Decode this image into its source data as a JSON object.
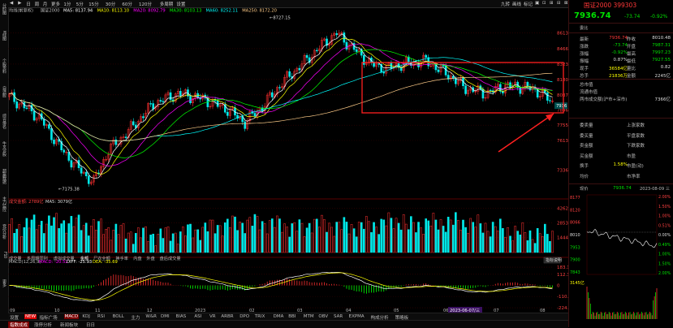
{
  "left_toolbar": {
    "items": [
      "分时图",
      "K线图",
      "个股资料",
      "自选股",
      "综合排名",
      "牛叉诊股",
      "超赢数据",
      "主力监控",
      "竞价分析",
      "F10",
      "更多"
    ]
  },
  "top_bar": {
    "items": [
      "◀",
      "▶",
      "日",
      "周",
      "月",
      "更多",
      "1分",
      "5分",
      "15分",
      "30分",
      "60分",
      "120分",
      "多周期",
      "设置"
    ],
    "right_items": [
      "九转",
      "画线",
      "标记",
      "▣",
      "⊡",
      "⊞",
      "⊟",
      "⊠"
    ]
  },
  "ma_legend": {
    "name": "均线(前复权)",
    "index_label": "国证2000",
    "items": [
      {
        "label": "MA5: 8137.94",
        "color": "#ffffff"
      },
      {
        "label": "MA10: 8113.10",
        "color": "#ffff00"
      },
      {
        "label": "MA20: 8092.79",
        "color": "#ff00ff"
      },
      {
        "label": "MA30: 8103.13",
        "color": "#00ff00"
      },
      {
        "label": "MA60: 8252.11",
        "color": "#00ffff"
      },
      {
        "label": "MA250: 8172.20",
        "color": "#ffcc88"
      }
    ]
  },
  "price_axis": [
    "8613",
    "8466",
    "8323",
    "8180",
    "8037",
    "7896",
    "7755",
    "7613"
  ],
  "price_axis_extra": "7336",
  "annotations": {
    "high": "8727.15",
    "low": "7175.38",
    "current_tag": "7936"
  },
  "volume_legend": {
    "label": "成交金额: 2789亿",
    "ma": "MA5: 3079亿"
  },
  "volume_axis": [
    "4262",
    "2853",
    "1444"
  ],
  "macd_legend": {
    "label": "MACD(12,26,9)",
    "macd": "MACD: -20.52",
    "diff": "DIFF: -25.93",
    "dea": "DEA: -35.69"
  },
  "macd_axis": [
    "183.1",
    "112.3",
    "0",
    "-110.6",
    "-224.1"
  ],
  "macd_button": "指标说明",
  "date_axis": [
    "09",
    "10",
    "11",
    "12",
    "2023",
    "02",
    "03",
    "04",
    "05",
    "06",
    "07",
    "08"
  ],
  "cursor_date": "2023-06-07/三",
  "indicator_tabs": [
    "设置",
    "NEW",
    "指标广场",
    "MACD",
    "KDJ",
    "RSI",
    "BOLL",
    "主力",
    "W&R",
    "DMI",
    "BIAS",
    "ASI",
    "VR",
    "ARBR",
    "DPO",
    "TRIX",
    "DMA",
    "BBI",
    "MTM",
    "OBV",
    "SAR",
    "EXPMA",
    "构成分析",
    "策略板"
  ],
  "sub_tabs": [
    "成交量",
    "多周期同列",
    "虚拟成交量",
    "金额",
    "尸衣全额",
    "换手率",
    "内盘",
    "外盘",
    "盘后成交量"
  ],
  "bottom_bar": [
    "指数成成",
    "涨停分析",
    "新闻板块",
    "日日"
  ],
  "quote_panel": {
    "title": "国证2000 399303",
    "price": "7936.74",
    "change": "-73.74",
    "change_pct": "-0.92%",
    "committee_label": "委比",
    "rows": [
      {
        "k": "最新",
        "v": "7936.74",
        "k2": "昨收",
        "v2": "8010.48",
        "vc": "red",
        "v2c": "white"
      },
      {
        "k": "涨跌",
        "v": "-73.74",
        "k2": "开盘",
        "v2": "7987.31",
        "vc": "green",
        "v2c": "green"
      },
      {
        "k": "涨幅",
        "v": "-0.92%",
        "k2": "最高",
        "v2": "7997.23",
        "vc": "green",
        "v2c": "green"
      },
      {
        "k": "振幅",
        "v": "0.87%",
        "k2": "最低",
        "v2": "7927.55",
        "vc": "white",
        "v2c": "green"
      },
      {
        "k": "现手",
        "v": "36584亿",
        "k2": "量比",
        "v2": "0.82",
        "vc": "yellow",
        "v2c": "white"
      },
      {
        "k": "总手",
        "v": "21836万",
        "k2": "金额",
        "v2": "2245亿",
        "vc": "yellow",
        "v2c": "white"
      }
    ],
    "rows2": [
      {
        "k": "总市值",
        "v": ""
      },
      {
        "k": "流通市值",
        "v": ""
      },
      {
        "k": "两市成交额(沪市+深市)",
        "v": "7366亿"
      }
    ],
    "rows3": [
      {
        "k": "委卖量",
        "k2": "上涨家数"
      },
      {
        "k": "委买量",
        "k2": "平盘家数"
      },
      {
        "k": "卖金额",
        "k2": "下跌家数"
      },
      {
        "k": "买金额",
        "k2": "市盈"
      },
      {
        "k": "换手",
        "v": "1.58%",
        "k2": "市盈(动)"
      },
      {
        "k": "均价",
        "k2": "市净率"
      }
    ],
    "now_label": "现价",
    "now_value": "7936.74",
    "now_date": "2023-08-09 三",
    "mini_axis_left": [
      "8177",
      "8120",
      "8066",
      "8010",
      "7953",
      "7900",
      "7843"
    ],
    "mini_axis_right": [
      "2.00%",
      "1.50%",
      "1.00%",
      "0.51%",
      "0.00%",
      "0.49%",
      "1.00%",
      "1.50%",
      "2.00%"
    ],
    "mini_vol_label": "3145亿"
  }
}
